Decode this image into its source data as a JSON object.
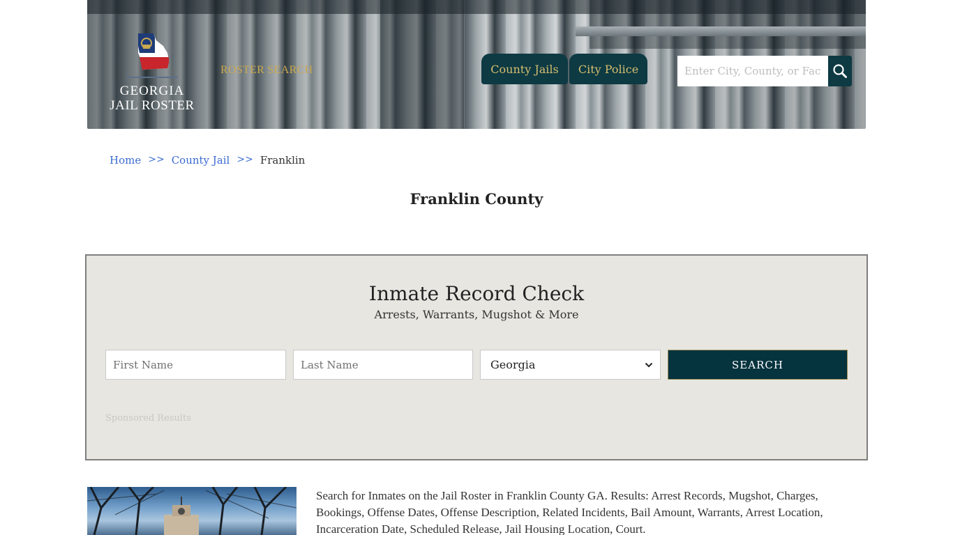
{
  "header": {
    "logo": {
      "line1": "GEORGIA",
      "line2": "JAIL ROSTER",
      "flag_colors": {
        "blue": "#1f3b78",
        "red": "#c8252c",
        "white": "#ffffff",
        "gold": "#c9a94f"
      }
    },
    "roster_search_label": "ROSTER SEARCH",
    "nav": [
      {
        "label": "County Jails"
      },
      {
        "label": "City Police"
      }
    ],
    "search": {
      "placeholder": "Enter City, County, or Facility",
      "value": "",
      "icon": "search-icon"
    },
    "accent_color": "#0d3a43",
    "nav_text_color": "#d6be6e"
  },
  "breadcrumb": {
    "items": [
      {
        "label": "Home"
      },
      {
        "label": "County Jail"
      }
    ],
    "separator": ">>",
    "current": "Franklin"
  },
  "page": {
    "title": "Franklin County"
  },
  "record_check": {
    "title": "Inmate Record Check",
    "subtitle": "Arrests, Warrants, Mugshot & More",
    "first_name": {
      "placeholder": "First Name",
      "value": ""
    },
    "last_name": {
      "placeholder": "Last Name",
      "value": ""
    },
    "state_select": {
      "selected": "Georgia",
      "icon": "chevron-down-icon"
    },
    "search_button": "SEARCH",
    "sponsored_label": "Sponsored Results"
  },
  "content": {
    "image_alt": "Franklin County courthouse among trees",
    "description": "Search for Inmates on the Jail Roster in Franklin County GA. Results: Arrest Records, Mugshot, Charges, Bookings, Offense Dates, Offense Description, Related Incidents, Bail Amount, Warrants, Arrest Location, Incarceration Date, Scheduled Release, Jail Housing Location, Court."
  }
}
